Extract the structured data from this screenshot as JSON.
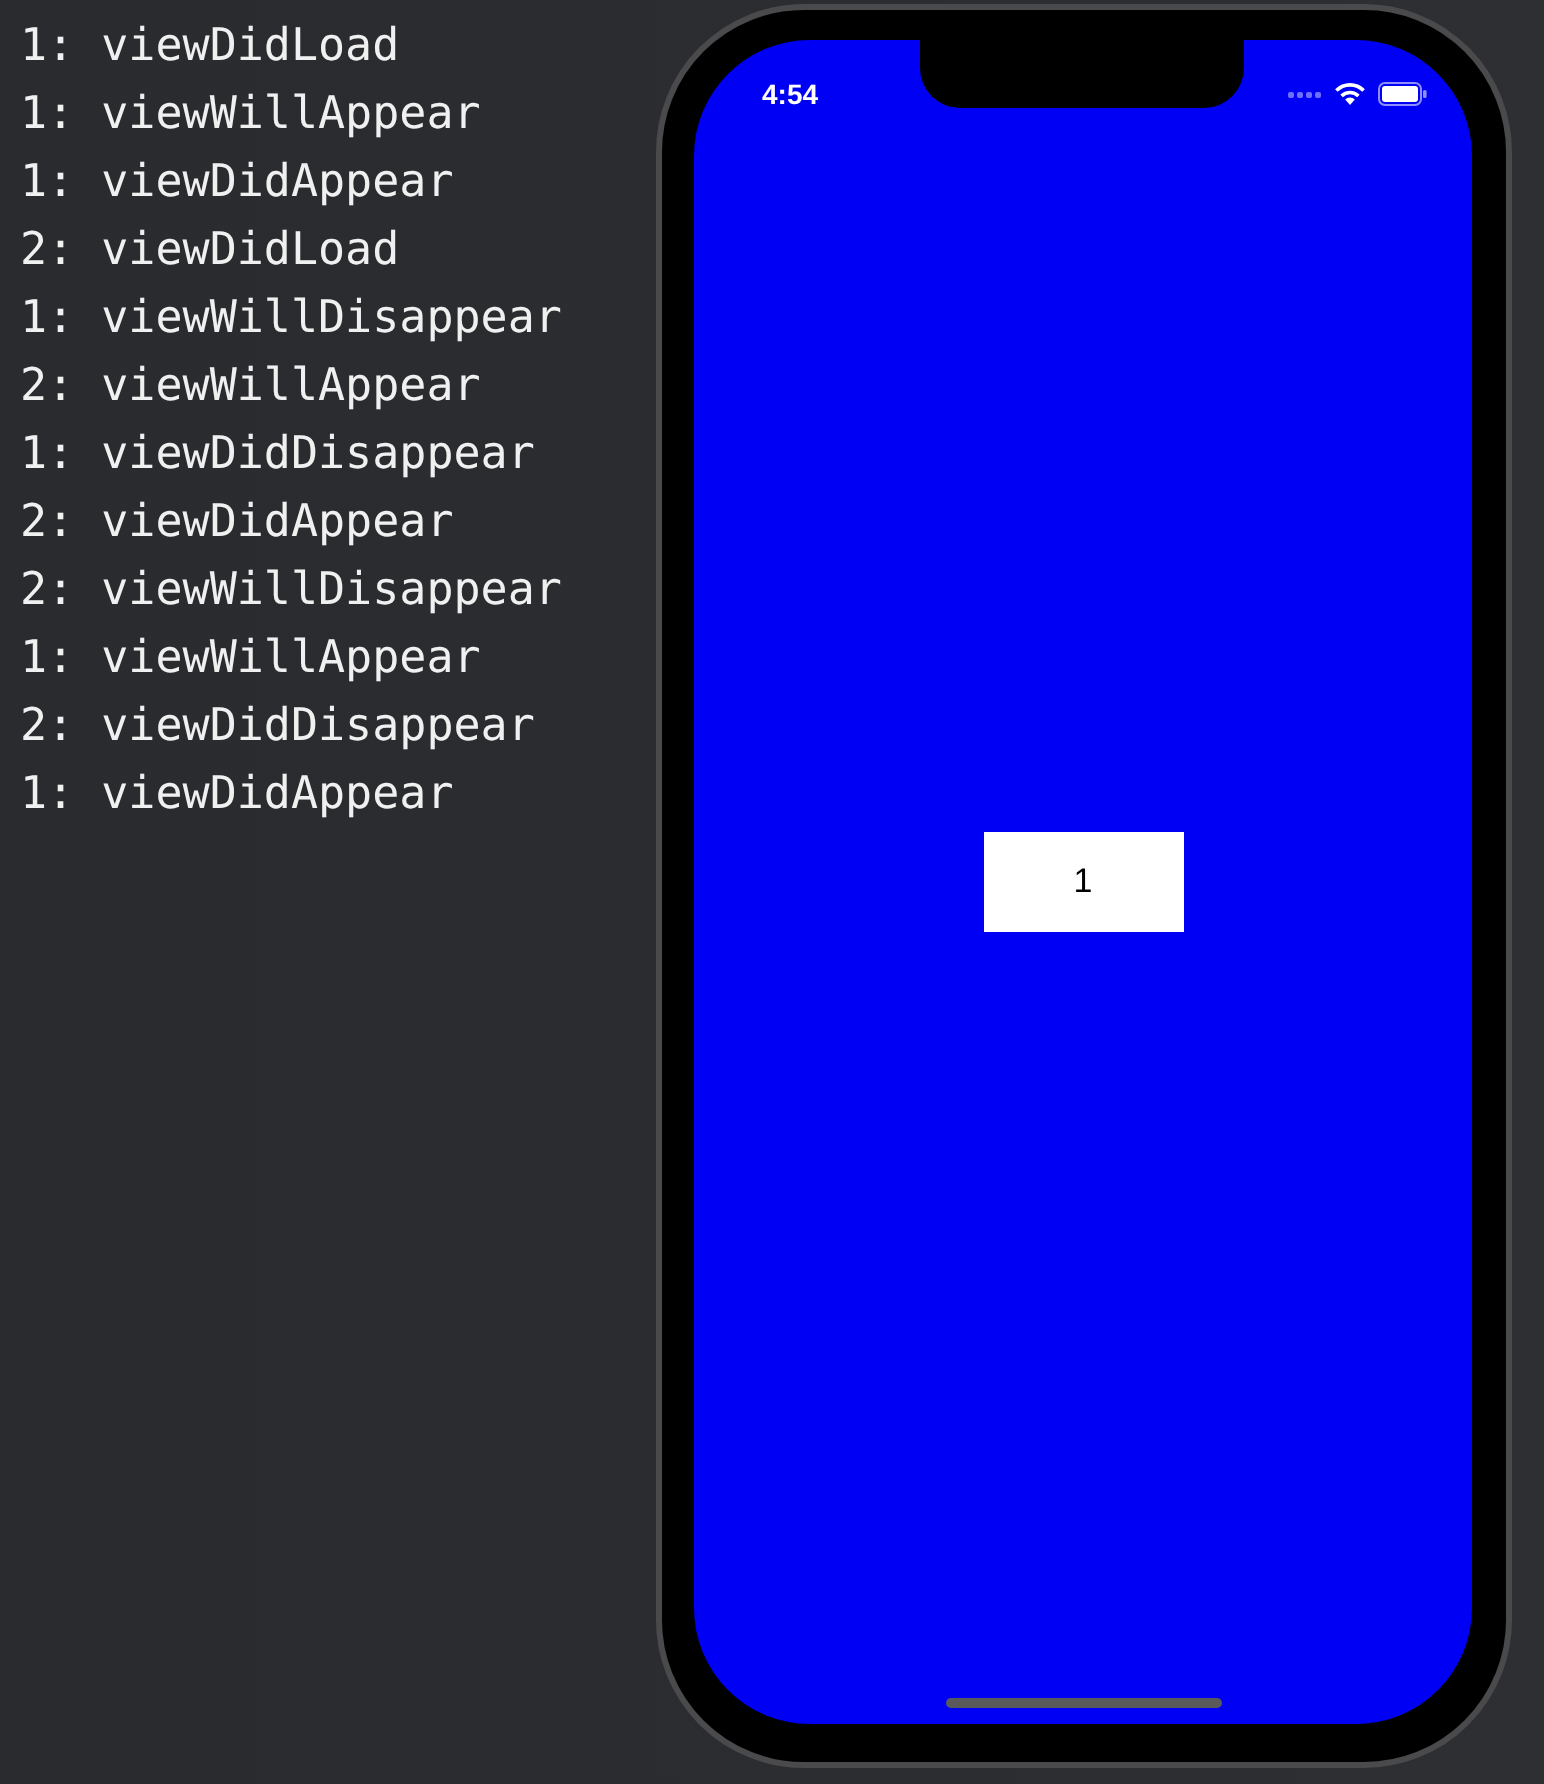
{
  "console": {
    "lines": [
      "1: viewDidLoad",
      "1: viewWillAppear",
      "1: viewDidAppear",
      "2: viewDidLoad",
      "1: viewWillDisappear",
      "2: viewWillAppear",
      "1: viewDidDisappear",
      "2: viewDidAppear",
      "2: viewWillDisappear",
      "1: viewWillAppear",
      "2: viewDidDisappear",
      "1: viewDidAppear"
    ]
  },
  "simulator": {
    "status_bar": {
      "time": "4:54"
    },
    "button": {
      "label": "1"
    }
  }
}
